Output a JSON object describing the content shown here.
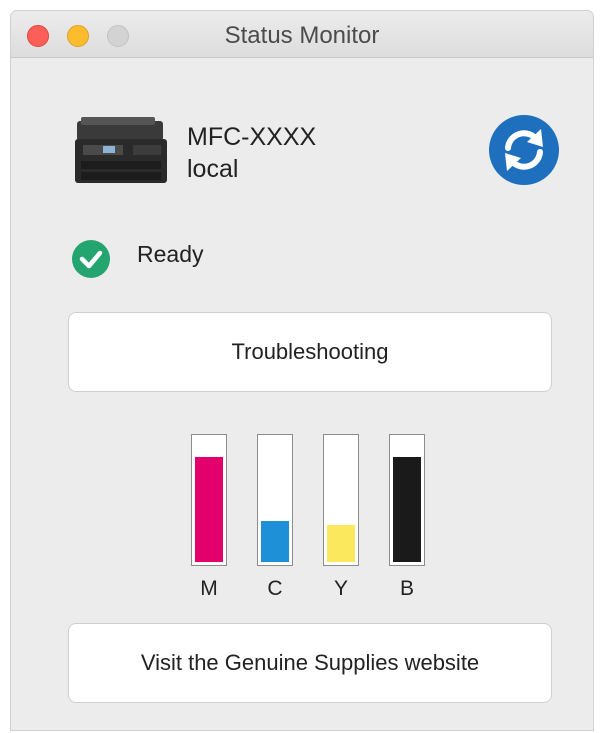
{
  "window": {
    "title": "Status Monitor"
  },
  "printer": {
    "name": "MFC-XXXX",
    "location": "local",
    "image_icon": "printer-icon",
    "refresh_icon": "refresh-icon"
  },
  "status": {
    "text": "Ready",
    "icon": "check-circle-icon",
    "color": "#24a46e"
  },
  "buttons": {
    "troubleshooting": "Troubleshooting",
    "supplies": "Visit the Genuine Supplies website"
  },
  "ink": [
    {
      "label": "M",
      "color": "#e3006d",
      "level": 0.85
    },
    {
      "label": "C",
      "color": "#1e90d8",
      "level": 0.33
    },
    {
      "label": "Y",
      "color": "#fbe85c",
      "level": 0.3
    },
    {
      "label": "B",
      "color": "#1a1a1a",
      "level": 0.85
    }
  ]
}
